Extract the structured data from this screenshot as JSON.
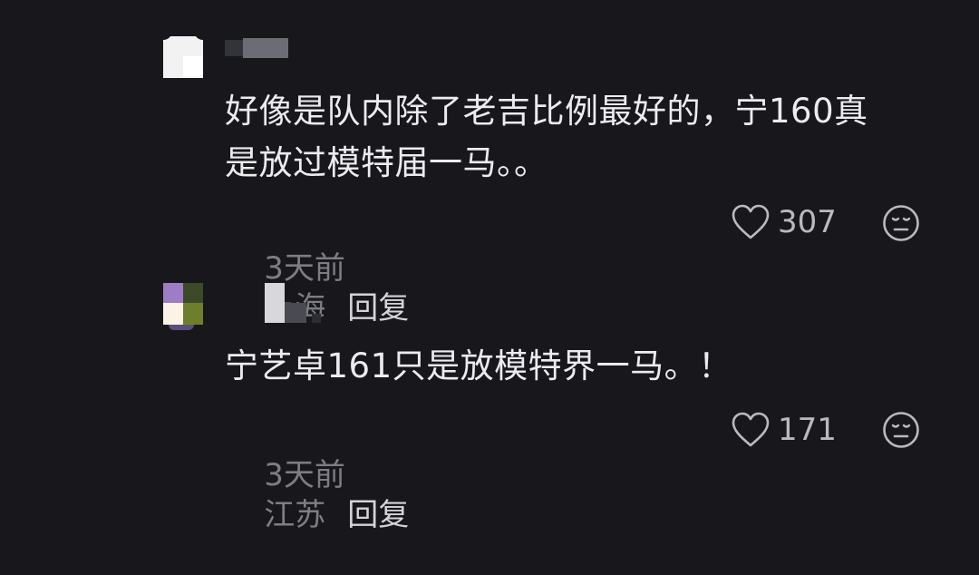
{
  "comments": [
    {
      "text_line1": "好像是队内除了老吉比例最好的，宁160真",
      "text_line2": "是放过模特届一马。。",
      "time": "3天前",
      "location": "上海",
      "reply_label": "回复",
      "like_count": "307",
      "like_icon": "heart-outline-icon",
      "reaction_icon": "meh-face-icon"
    },
    {
      "text_line1": "宁艺卓161只是放模特界一马。！",
      "time": "3天前",
      "location": "江苏",
      "reply_label": "回复",
      "like_count": "171",
      "like_icon": "heart-outline-icon",
      "reaction_icon": "meh-face-icon"
    }
  ],
  "colors": {
    "background": "#17171c",
    "text": "#ececef",
    "meta": "#7d7d84",
    "reply": "#d4d4d8",
    "icon": "#b9b9bf"
  }
}
